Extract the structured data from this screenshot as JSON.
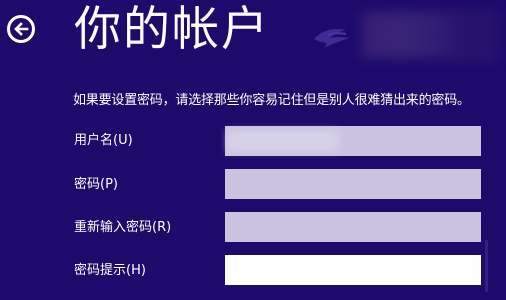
{
  "header": {
    "title": "你的帐户",
    "back_icon": "back-arrow-icon"
  },
  "instruction": "如果要设置密码，请选择那些你容易记住但是别人很难猜出来的密码。",
  "form": {
    "username_label": "用户名(U)",
    "username_value": "",
    "password_label": "密码(P)",
    "password_value": "",
    "confirm_label": "重新输入密码(R)",
    "confirm_value": "",
    "hint_label": "密码提示(H)",
    "hint_value": ""
  },
  "colors": {
    "background": "#1e0a6b",
    "input_inactive": "#c9c3e0",
    "input_active": "#ffffff",
    "text": "#ffffff"
  }
}
